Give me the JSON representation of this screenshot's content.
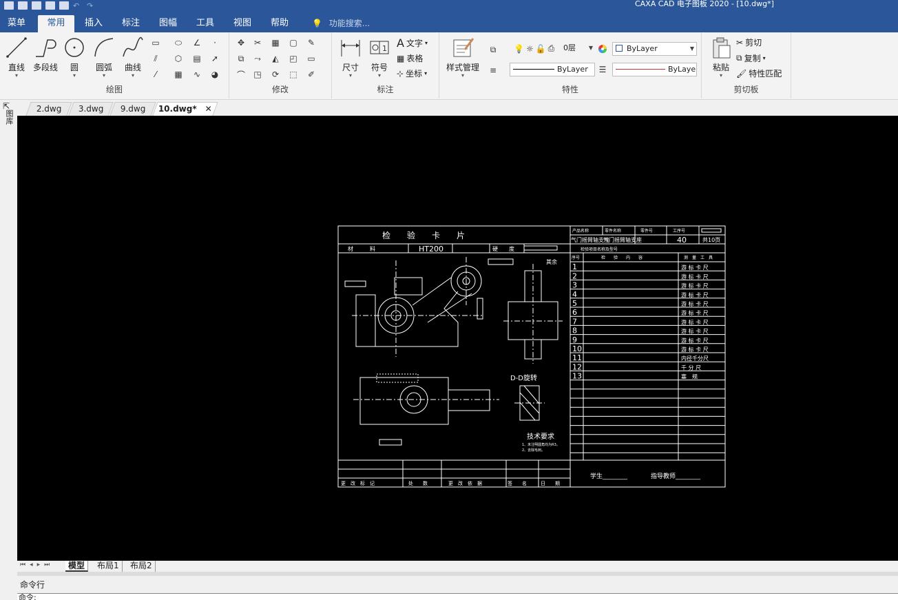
{
  "title_bar": {
    "title": "CAXA CAD 电子图板 2020 - [10.dwg*]"
  },
  "menu": {
    "tabs": [
      "菜单",
      "常用",
      "插入",
      "标注",
      "图幅",
      "工具",
      "视图",
      "帮助"
    ],
    "active": "常用",
    "search_placeholder": "功能搜索..."
  },
  "ribbon": {
    "draw": {
      "label": "绘图",
      "line": "直线",
      "polyline": "多段线",
      "circle": "圆",
      "arc": "圆弧",
      "curve": "曲线"
    },
    "modify": {
      "label": "修改"
    },
    "annotate": {
      "label": "标注",
      "dimension": "尺寸",
      "symbol": "符号",
      "text": "文字",
      "table": "表格",
      "coordinate": "坐标"
    },
    "properties": {
      "label": "特性",
      "style_manager": "样式管理",
      "layer": "0层",
      "color": "ByLayer",
      "linetype": "ByLayer",
      "lineweight": "ByLaye"
    },
    "clipboard": {
      "label": "剪切板",
      "paste": "粘贴",
      "cut": "剪切",
      "copy": "复制",
      "match": "特性匹配"
    }
  },
  "left_strip": {
    "label": "图库"
  },
  "doc_tabs": [
    "2.dwg",
    "3.dwg",
    "9.dwg",
    "10.dwg*"
  ],
  "active_doc": "10.dwg*",
  "drawing": {
    "title": "检　　验　　卡　　片",
    "material_label": "材　　　料",
    "material": "HT200",
    "hardness_label": "硬　　度",
    "header_product": "产品名称",
    "header_part": "零件名称",
    "header_part_no": "零件号",
    "header_process": "工序号",
    "product_name": "气门摇臂轴支座",
    "part_name": "气门摇臂轴支座",
    "process_no": "40",
    "sheet_no": "共10页",
    "check_header": "检验项目名称及型号",
    "col_no": "序号",
    "col_content": "检　　验　　内　　容",
    "col_tool": "测　量　工　具",
    "rows": [
      {
        "n": "1",
        "tool": "游 标 卡 尺"
      },
      {
        "n": "2",
        "tool": "游 标 卡 尺"
      },
      {
        "n": "3",
        "tool": "游 标 卡 尺"
      },
      {
        "n": "4",
        "tool": "游 标 卡 尺"
      },
      {
        "n": "5",
        "tool": "游 标 卡 尺"
      },
      {
        "n": "6",
        "tool": "游 标 卡 尺"
      },
      {
        "n": "7",
        "tool": "游 标 卡 尺"
      },
      {
        "n": "8",
        "tool": "游 标 卡 尺"
      },
      {
        "n": "9",
        "tool": "游 标 卡 尺"
      },
      {
        "n": "10",
        "tool": "游 标 卡 尺"
      },
      {
        "n": "11",
        "tool": "内径千分尺"
      },
      {
        "n": "12",
        "tool": "千 分 尺"
      },
      {
        "n": "13",
        "tool": "塞　规"
      }
    ],
    "section_label": "D-D旋转",
    "tech_title": "技术要求",
    "tech_lines": [
      "1、未注明圆角均为R3。",
      "2、去除毛刺。"
    ],
    "student": "学生________",
    "teacher": "指导教师________",
    "footer_cells": [
      "更　改　标　记",
      "处　　数",
      "更　改　依　据",
      "签　　名",
      "日　　期"
    ],
    "roughness_note": "其余"
  },
  "layout_tabs": [
    "模型",
    "布局1",
    "布局2"
  ],
  "active_layout": "模型",
  "command": {
    "label": "命令行",
    "prompt": "命令:"
  }
}
